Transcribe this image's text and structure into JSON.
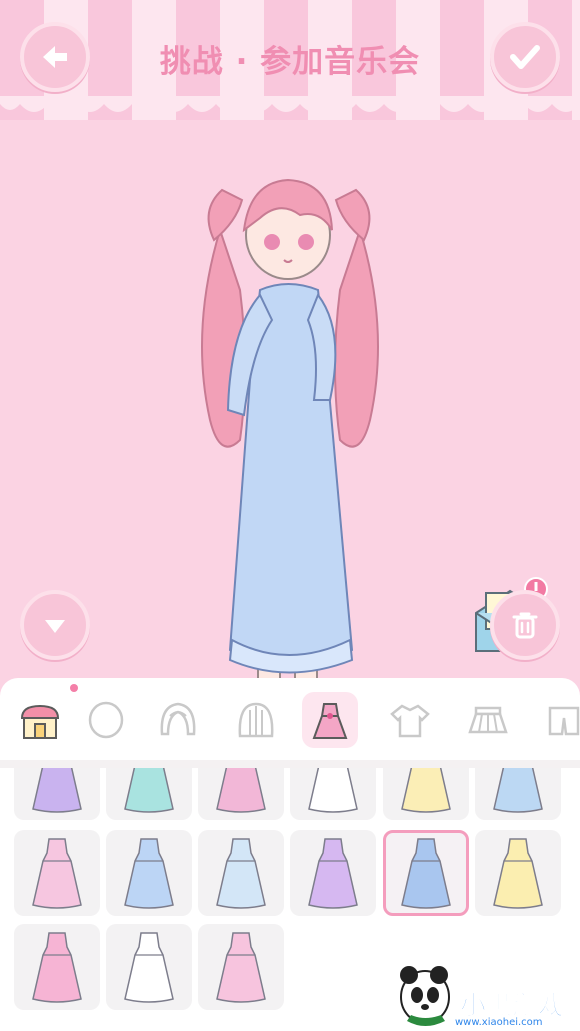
{
  "header": {
    "title": "挑战 · 参加音乐会",
    "back_icon": "arrow-left-icon",
    "confirm_icon": "checkmark-icon"
  },
  "colors": {
    "background": "#fbd3e3",
    "accent": "#f08eb2",
    "button": "#f8c5d8",
    "selected_border": "#f49dbd"
  },
  "tabs": [
    {
      "name": "shop-icon",
      "active": false
    },
    {
      "name": "face-icon",
      "active": false
    },
    {
      "name": "hair-front-icon",
      "active": false
    },
    {
      "name": "hair-back-icon",
      "active": false
    },
    {
      "name": "dress-icon",
      "active": true
    },
    {
      "name": "top-icon",
      "active": false
    },
    {
      "name": "skirt-icon",
      "active": false
    },
    {
      "name": "pants-icon",
      "active": false
    }
  ],
  "items": [
    {
      "name": "dress-item-1",
      "color": "#c9b3ef",
      "selected": false
    },
    {
      "name": "dress-item-2",
      "color": "#a9e3e0",
      "selected": false
    },
    {
      "name": "dress-item-3",
      "color": "#f2b7d7",
      "selected": false
    },
    {
      "name": "dress-item-4",
      "color": "#ffffff",
      "selected": false
    },
    {
      "name": "dress-item-5",
      "color": "#fbeeb6",
      "selected": false
    },
    {
      "name": "dress-item-6",
      "color": "#bcd8f3",
      "selected": false
    },
    {
      "name": "dress-item-7",
      "color": "#f6c6e0",
      "selected": false
    },
    {
      "name": "dress-item-8",
      "color": "#bcd5f5",
      "selected": false
    },
    {
      "name": "dress-item-9",
      "color": "#d3e6f7",
      "selected": false
    },
    {
      "name": "dress-item-10",
      "color": "#d6b8f1",
      "selected": false
    },
    {
      "name": "dress-item-11",
      "color": "#a9c6ef",
      "selected": true
    },
    {
      "name": "dress-item-12",
      "color": "#fbeeb0",
      "selected": false
    },
    {
      "name": "dress-item-13",
      "color": "#f6b4d4",
      "selected": false
    },
    {
      "name": "dress-item-14",
      "color": "#ffffff",
      "selected": false
    },
    {
      "name": "dress-item-15",
      "color": "#f7c4de",
      "selected": false
    }
  ],
  "watermark": {
    "brand": "小黑游戏",
    "url": "www.xiaohei.com"
  }
}
